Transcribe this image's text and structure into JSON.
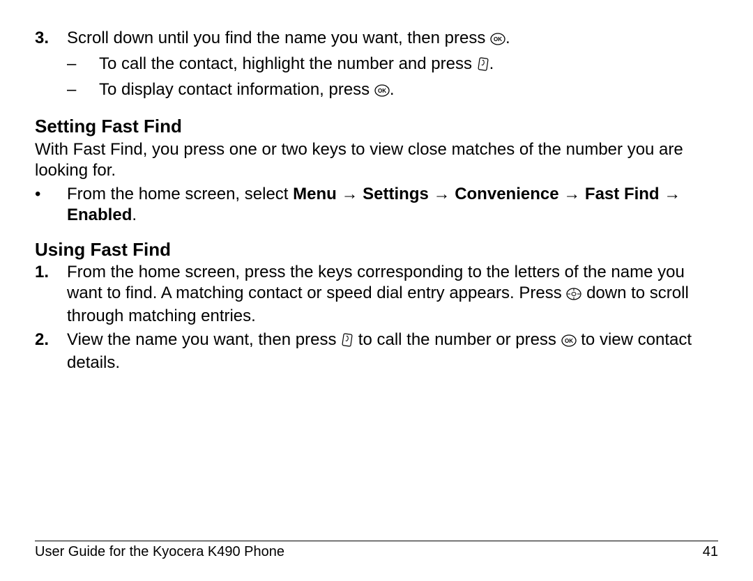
{
  "step3": {
    "num": "3.",
    "text_a": "Scroll down until you find the name you want, then press ",
    "text_b": ".",
    "sub1_a": "To call the contact, highlight the number and press ",
    "sub1_b": ".",
    "sub2_a": "To display contact information, press ",
    "sub2_b": ".",
    "dash": "–"
  },
  "setting": {
    "heading": "Setting Fast Find",
    "intro": "With Fast Find, you press one or two keys to view close matches of the number you are looking for.",
    "bullet_mark": "•",
    "bullet_lead": "From the home screen, select ",
    "path_menu": "Menu",
    "path_settings": "Settings",
    "path_convenience": "Convenience",
    "path_fastfind": "Fast Find",
    "path_enabled": "Enabled",
    "arrow": " → ",
    "period": "."
  },
  "using": {
    "heading": "Using Fast Find",
    "s1_num": "1.",
    "s1_a": "From the home screen, press the keys corresponding to the letters of the name you want to find. A matching contact or speed dial entry appears. Press ",
    "s1_b": " down to scroll through matching entries.",
    "s2_num": "2.",
    "s2_a": "View the name you want, then press ",
    "s2_b": " to call the number or press ",
    "s2_c": " to view contact details."
  },
  "footer": {
    "left": "User Guide for the Kyocera K490 Phone",
    "right": "41"
  }
}
